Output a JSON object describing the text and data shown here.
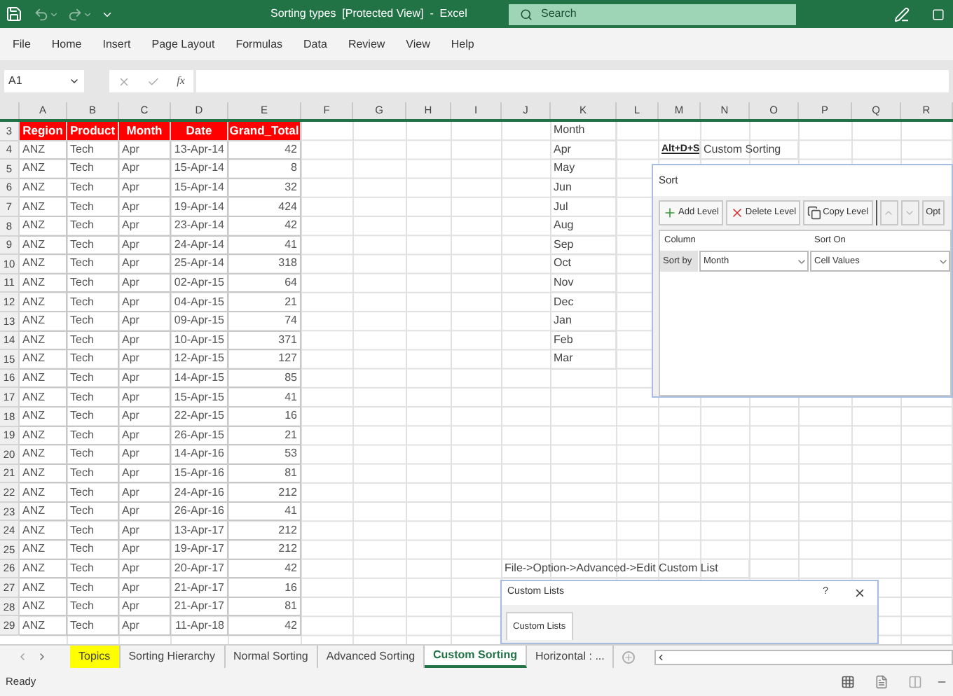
{
  "title_bar": {
    "title": "Sorting types  [Protected View]  -  Excel",
    "search_placeholder": "Search"
  },
  "menu": [
    "File",
    "Home",
    "Insert",
    "Page Layout",
    "Formulas",
    "Data",
    "Review",
    "View",
    "Help"
  ],
  "formula_bar": {
    "name_box": "A1",
    "function_label": "fx"
  },
  "column_headers": [
    "A",
    "B",
    "C",
    "D",
    "E",
    "F",
    "G",
    "H",
    "I",
    "J",
    "K",
    "L",
    "M",
    "N",
    "O",
    "P",
    "Q",
    "R"
  ],
  "table": {
    "header_row_number": "3",
    "columns": [
      "Region",
      "Product",
      "Month",
      "Date",
      "Grand_Total"
    ],
    "rows": [
      {
        "number": "4",
        "cells": [
          "ANZ",
          "Tech",
          "Apr",
          "13-Apr-14",
          "42"
        ]
      },
      {
        "number": "5",
        "cells": [
          "ANZ",
          "Tech",
          "Apr",
          "15-Apr-14",
          "8"
        ]
      },
      {
        "number": "6",
        "cells": [
          "ANZ",
          "Tech",
          "Apr",
          "15-Apr-14",
          "32"
        ]
      },
      {
        "number": "7",
        "cells": [
          "ANZ",
          "Tech",
          "Apr",
          "19-Apr-14",
          "424"
        ]
      },
      {
        "number": "8",
        "cells": [
          "ANZ",
          "Tech",
          "Apr",
          "23-Apr-14",
          "42"
        ]
      },
      {
        "number": "9",
        "cells": [
          "ANZ",
          "Tech",
          "Apr",
          "24-Apr-14",
          "41"
        ]
      },
      {
        "number": "10",
        "cells": [
          "ANZ",
          "Tech",
          "Apr",
          "25-Apr-14",
          "318"
        ]
      },
      {
        "number": "11",
        "cells": [
          "ANZ",
          "Tech",
          "Apr",
          "02-Apr-15",
          "64"
        ]
      },
      {
        "number": "12",
        "cells": [
          "ANZ",
          "Tech",
          "Apr",
          "04-Apr-15",
          "21"
        ]
      },
      {
        "number": "13",
        "cells": [
          "ANZ",
          "Tech",
          "Apr",
          "09-Apr-15",
          "74"
        ]
      },
      {
        "number": "14",
        "cells": [
          "ANZ",
          "Tech",
          "Apr",
          "10-Apr-15",
          "371"
        ]
      },
      {
        "number": "15",
        "cells": [
          "ANZ",
          "Tech",
          "Apr",
          "12-Apr-15",
          "127"
        ]
      },
      {
        "number": "16",
        "cells": [
          "ANZ",
          "Tech",
          "Apr",
          "14-Apr-15",
          "85"
        ]
      },
      {
        "number": "17",
        "cells": [
          "ANZ",
          "Tech",
          "Apr",
          "15-Apr-15",
          "41"
        ]
      },
      {
        "number": "18",
        "cells": [
          "ANZ",
          "Tech",
          "Apr",
          "22-Apr-15",
          "16"
        ]
      },
      {
        "number": "19",
        "cells": [
          "ANZ",
          "Tech",
          "Apr",
          "26-Apr-15",
          "21"
        ]
      },
      {
        "number": "20",
        "cells": [
          "ANZ",
          "Tech",
          "Apr",
          "14-Apr-16",
          "53"
        ]
      },
      {
        "number": "21",
        "cells": [
          "ANZ",
          "Tech",
          "Apr",
          "15-Apr-16",
          "81"
        ]
      },
      {
        "number": "22",
        "cells": [
          "ANZ",
          "Tech",
          "Apr",
          "24-Apr-16",
          "212"
        ]
      },
      {
        "number": "23",
        "cells": [
          "ANZ",
          "Tech",
          "Apr",
          "26-Apr-16",
          "41"
        ]
      },
      {
        "number": "24",
        "cells": [
          "ANZ",
          "Tech",
          "Apr",
          "13-Apr-17",
          "212"
        ]
      },
      {
        "number": "25",
        "cells": [
          "ANZ",
          "Tech",
          "Apr",
          "19-Apr-17",
          "212"
        ]
      },
      {
        "number": "26",
        "cells": [
          "ANZ",
          "Tech",
          "Apr",
          "20-Apr-17",
          "42"
        ]
      },
      {
        "number": "27",
        "cells": [
          "ANZ",
          "Tech",
          "Apr",
          "21-Apr-17",
          "16"
        ]
      },
      {
        "number": "28",
        "cells": [
          "ANZ",
          "Tech",
          "Apr",
          "21-Apr-17",
          "81"
        ]
      },
      {
        "number": "29",
        "cells": [
          "ANZ",
          "Tech",
          "Apr",
          "11-Apr-18",
          "42"
        ]
      }
    ]
  },
  "month_list": [
    "Month",
    "Apr",
    "May",
    "Jun",
    "Jul",
    "Aug",
    "Sep",
    "Oct",
    "Nov",
    "Dec",
    "Jan",
    "Feb",
    "Mar"
  ],
  "shortcut": {
    "keys": "Alt+D+S",
    "label": "Custom Sorting"
  },
  "path_note": "File->Option->Advanced->Edit Custom List",
  "sort_dialog": {
    "title": "Sort",
    "buttons": [
      "Add Level",
      "Delete Level",
      "Copy Level"
    ],
    "options_button": "Opt",
    "column_heading": "Column",
    "sort_on_heading": "Sort On",
    "row_label": "Sort by",
    "column_value": "Month",
    "sort_on_value": "Cell Values"
  },
  "custom_lists_dialog": {
    "title": "Custom Lists",
    "help": "?",
    "tab": "Custom Lists"
  },
  "sheet_tabs": [
    {
      "label": "Topics",
      "selected": false,
      "color": "#ffff00"
    },
    {
      "label": "Sorting Hierarchy",
      "selected": false
    },
    {
      "label": "Normal Sorting",
      "selected": false
    },
    {
      "label": "Advanced Sorting",
      "selected": false
    },
    {
      "label": "Custom Sorting",
      "selected": true
    },
    {
      "label": "Horizontal : ...",
      "selected": false
    }
  ],
  "status_bar": {
    "text": "Ready"
  }
}
